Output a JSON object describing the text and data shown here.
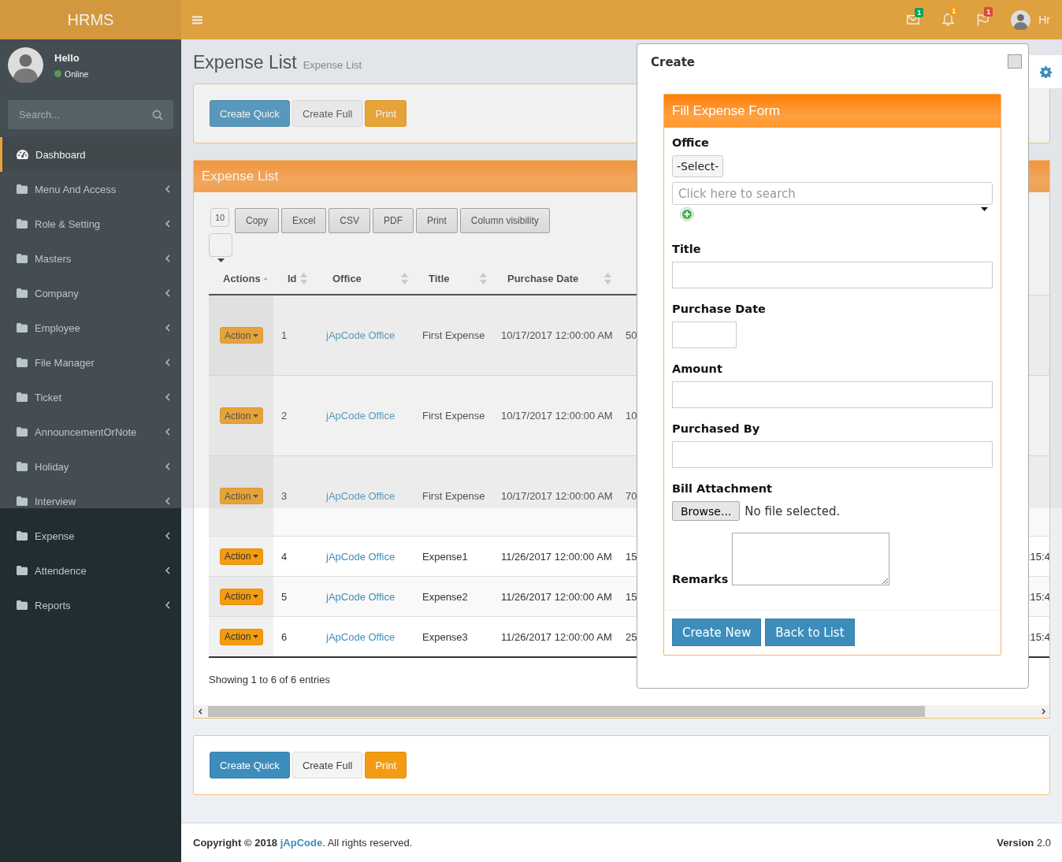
{
  "brand": "HRMS",
  "topbar": {
    "notifications": [
      {
        "kind": "mail",
        "count": "1",
        "color": "#00a65a"
      },
      {
        "kind": "bell",
        "count": "1",
        "color": "#f39c12"
      },
      {
        "kind": "flag",
        "count": "1",
        "color": "#dd4b39"
      }
    ],
    "user": "Hr"
  },
  "sidebar": {
    "greeting": "Hello",
    "status": "Online",
    "search_placeholder": "Search...",
    "items": [
      {
        "label": "Dashboard",
        "kind": "dashboard",
        "selected": true,
        "expandable": false
      },
      {
        "label": "Menu And Access",
        "kind": "folder",
        "selected": false,
        "expandable": true
      },
      {
        "label": "Role & Setting",
        "kind": "folder",
        "selected": false,
        "expandable": true
      },
      {
        "label": "Masters",
        "kind": "folder",
        "selected": false,
        "expandable": true
      },
      {
        "label": "Company",
        "kind": "folder",
        "selected": false,
        "expandable": true
      },
      {
        "label": "Employee",
        "kind": "folder",
        "selected": false,
        "expandable": true
      },
      {
        "label": "File Manager",
        "kind": "folder",
        "selected": false,
        "expandable": true
      },
      {
        "label": "Ticket",
        "kind": "folder",
        "selected": false,
        "expandable": true
      },
      {
        "label": "AnnouncementOrNote",
        "kind": "folder",
        "selected": false,
        "expandable": true
      },
      {
        "label": "Holiday",
        "kind": "folder",
        "selected": false,
        "expandable": true
      },
      {
        "label": "Interview",
        "kind": "folder",
        "selected": false,
        "expandable": true
      },
      {
        "label": "Expense",
        "kind": "folder",
        "selected": false,
        "expandable": true
      },
      {
        "label": "Attendence",
        "kind": "folder",
        "selected": false,
        "expandable": true
      },
      {
        "label": "Reports",
        "kind": "folder",
        "selected": false,
        "expandable": true
      }
    ]
  },
  "page": {
    "title": "Expense List",
    "subtitle": "Expense List"
  },
  "top_buttons": [
    {
      "label": "Create Quick",
      "kind": "primary"
    },
    {
      "label": "Create Full",
      "kind": "default"
    },
    {
      "label": "Print",
      "kind": "warning"
    }
  ],
  "expense_panel": {
    "title": "Expense List",
    "page_length": "10",
    "export_buttons": [
      "Copy",
      "Excel",
      "CSV",
      "PDF",
      "Print",
      "Column visibility"
    ],
    "columns": [
      {
        "label": "Actions",
        "sorted": true
      },
      {
        "label": "Id",
        "sorted": false
      },
      {
        "label": "Office",
        "sorted": false
      },
      {
        "label": "Title",
        "sorted": false
      },
      {
        "label": "Purchase Date",
        "sorted": false
      }
    ],
    "rows": [
      {
        "kind": "tall",
        "cells": [
          "Action",
          "1",
          "jApCode Office",
          "First Expense",
          "10/17/2017 12:00:00 AM",
          "50"
        ]
      },
      {
        "kind": "tall",
        "cells": [
          "Action",
          "2",
          "jApCode Office",
          "First Expense",
          "10/17/2017 12:00:00 AM",
          "10"
        ]
      },
      {
        "kind": "tall",
        "cells": [
          "Action",
          "3",
          "jApCode Office",
          "First Expense",
          "10/17/2017 12:00:00 AM",
          "70"
        ]
      },
      {
        "kind": "normal",
        "cells": [
          "Action",
          "4",
          "jApCode Office",
          "Expense1",
          "11/26/2017 12:00:00 AM",
          "15",
          "",
          ":15:4"
        ]
      },
      {
        "kind": "normal",
        "cells": [
          "Action",
          "5",
          "jApCode Office",
          "Expense2",
          "11/26/2017 12:00:00 AM",
          "15",
          "",
          ":15:4"
        ]
      },
      {
        "kind": "normal",
        "cells": [
          "Action",
          "6",
          "jApCode Office",
          "Expense3",
          "11/26/2017 12:00:00 AM",
          "25",
          "",
          ":15:4"
        ]
      }
    ],
    "info": "Showing 1 to 6 of 6 entries"
  },
  "bottom_buttons": [
    {
      "label": "Create Quick",
      "kind": "primary"
    },
    {
      "label": "Create Full",
      "kind": "default"
    },
    {
      "label": "Print",
      "kind": "warning"
    }
  ],
  "modal": {
    "title": "Create",
    "panel_title": "Fill Expense Form",
    "office": {
      "label": "Office",
      "select": "-Select-",
      "search_placeholder": "Click here to search"
    },
    "fields": [
      {
        "label": "Title",
        "kind": "text"
      },
      {
        "label": "Purchase Date",
        "kind": "date"
      },
      {
        "label": "Amount",
        "kind": "text"
      },
      {
        "label": "Purchased By",
        "kind": "text"
      },
      {
        "label": "Bill Attachment",
        "kind": "file",
        "button": "Browse...",
        "value": "No file selected."
      },
      {
        "label": "Remarks",
        "kind": "textarea"
      }
    ],
    "buttons": [
      "Create New",
      "Back to List"
    ]
  },
  "footer": {
    "copyright": "**Copyright © 2018**",
    "link": "jApCode",
    "rest": ". All rights reserved.",
    "version": "**Version** 2.0"
  }
}
